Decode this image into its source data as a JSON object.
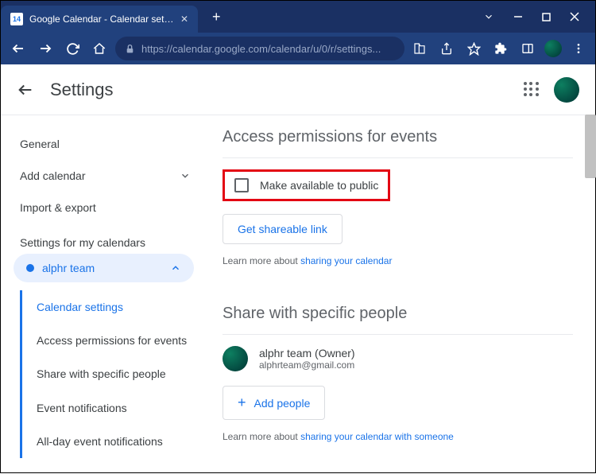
{
  "browser": {
    "tab_title": "Google Calendar - Calendar settin",
    "url": "https://calendar.google.com/calendar/u/0/r/settings..."
  },
  "header": {
    "title": "Settings"
  },
  "sidebar": {
    "general": "General",
    "add_calendar": "Add calendar",
    "import_export": "Import & export",
    "section_label": "Settings for my calendars",
    "calendar_name": "alphr team",
    "sub_items": {
      "calendar_settings": "Calendar settings",
      "access_permissions": "Access permissions for events",
      "share_specific": "Share with specific people",
      "event_notifications": "Event notifications",
      "allday_notifications": "All-day event notifications"
    }
  },
  "main": {
    "access_title": "Access permissions for events",
    "public_checkbox_label": "Make available to public",
    "shareable_link_btn": "Get shareable link",
    "learn_prefix": "Learn more about ",
    "learn_link1": "sharing your calendar",
    "share_title": "Share with specific people",
    "person_name": "alphr team (Owner)",
    "person_email": "alphrteam@gmail.com",
    "add_people_btn": "Add people",
    "learn_link2": "sharing your calendar with someone"
  }
}
